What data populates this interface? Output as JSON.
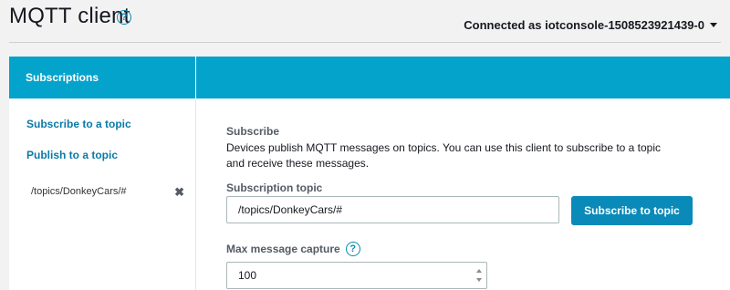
{
  "header": {
    "title": "MQTT client",
    "help_icon": "question-circle-icon",
    "connection_label": "Connected as iotconsole-1508523921439-0",
    "connection_caret_icon": "caret-down-icon"
  },
  "panel": {
    "header_title": "Subscriptions",
    "accent_color": "#04a3cc"
  },
  "sidebar": {
    "links": [
      {
        "label": "Subscribe to a topic"
      },
      {
        "label": "Publish to a topic"
      }
    ],
    "subscriptions": [
      {
        "topic": "/topics/DonkeyCars/#",
        "remove_icon": "close-icon"
      }
    ]
  },
  "main": {
    "section_title": "Subscribe",
    "description": "Devices publish MQTT messages on topics. You can use this client to subscribe to a topic and receive these messages.",
    "topic_label": "Subscription topic",
    "topic_value": "/topics/DonkeyCars/#",
    "subscribe_button_label": "Subscribe to topic",
    "max_capture_label": "Max message capture",
    "max_capture_value": "100"
  }
}
